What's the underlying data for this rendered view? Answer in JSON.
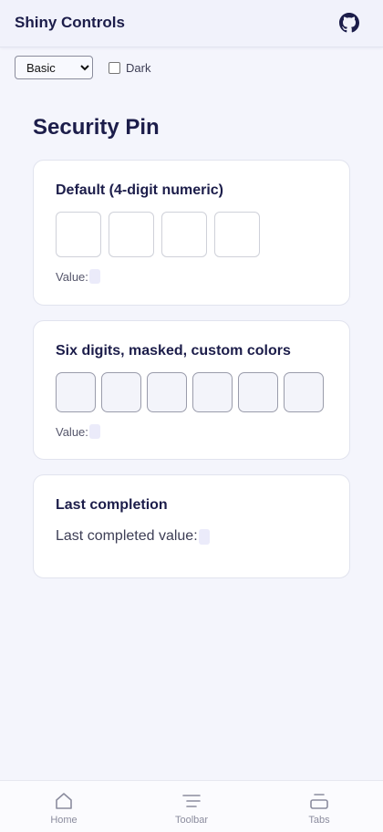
{
  "app": {
    "title": "Shiny Controls",
    "github_icon": "github-icon"
  },
  "controls": {
    "theme_select": {
      "selected": "Basic",
      "options": [
        "Basic"
      ]
    },
    "dark_label": "Dark",
    "dark_checked": false
  },
  "page": {
    "title": "Security Pin"
  },
  "cards": {
    "default": {
      "title": "Default (4-digit numeric)",
      "digits": 4,
      "value_label": "Value:",
      "value": ""
    },
    "six": {
      "title": "Six digits, masked, custom colors",
      "digits": 6,
      "value_label": "Value:",
      "value": ""
    },
    "last": {
      "title": "Last completion",
      "value_label": "Last completed value:",
      "value": ""
    }
  },
  "nav": {
    "items": [
      {
        "label": "Home",
        "icon": "home-icon"
      },
      {
        "label": "Toolbar",
        "icon": "toolbar-icon"
      },
      {
        "label": "Tabs",
        "icon": "tabs-icon"
      }
    ]
  },
  "colors": {
    "background": "#f4f5fc",
    "text": "#1c1d4a",
    "card": "#ffffff",
    "value_chip": "#ebebfa"
  }
}
